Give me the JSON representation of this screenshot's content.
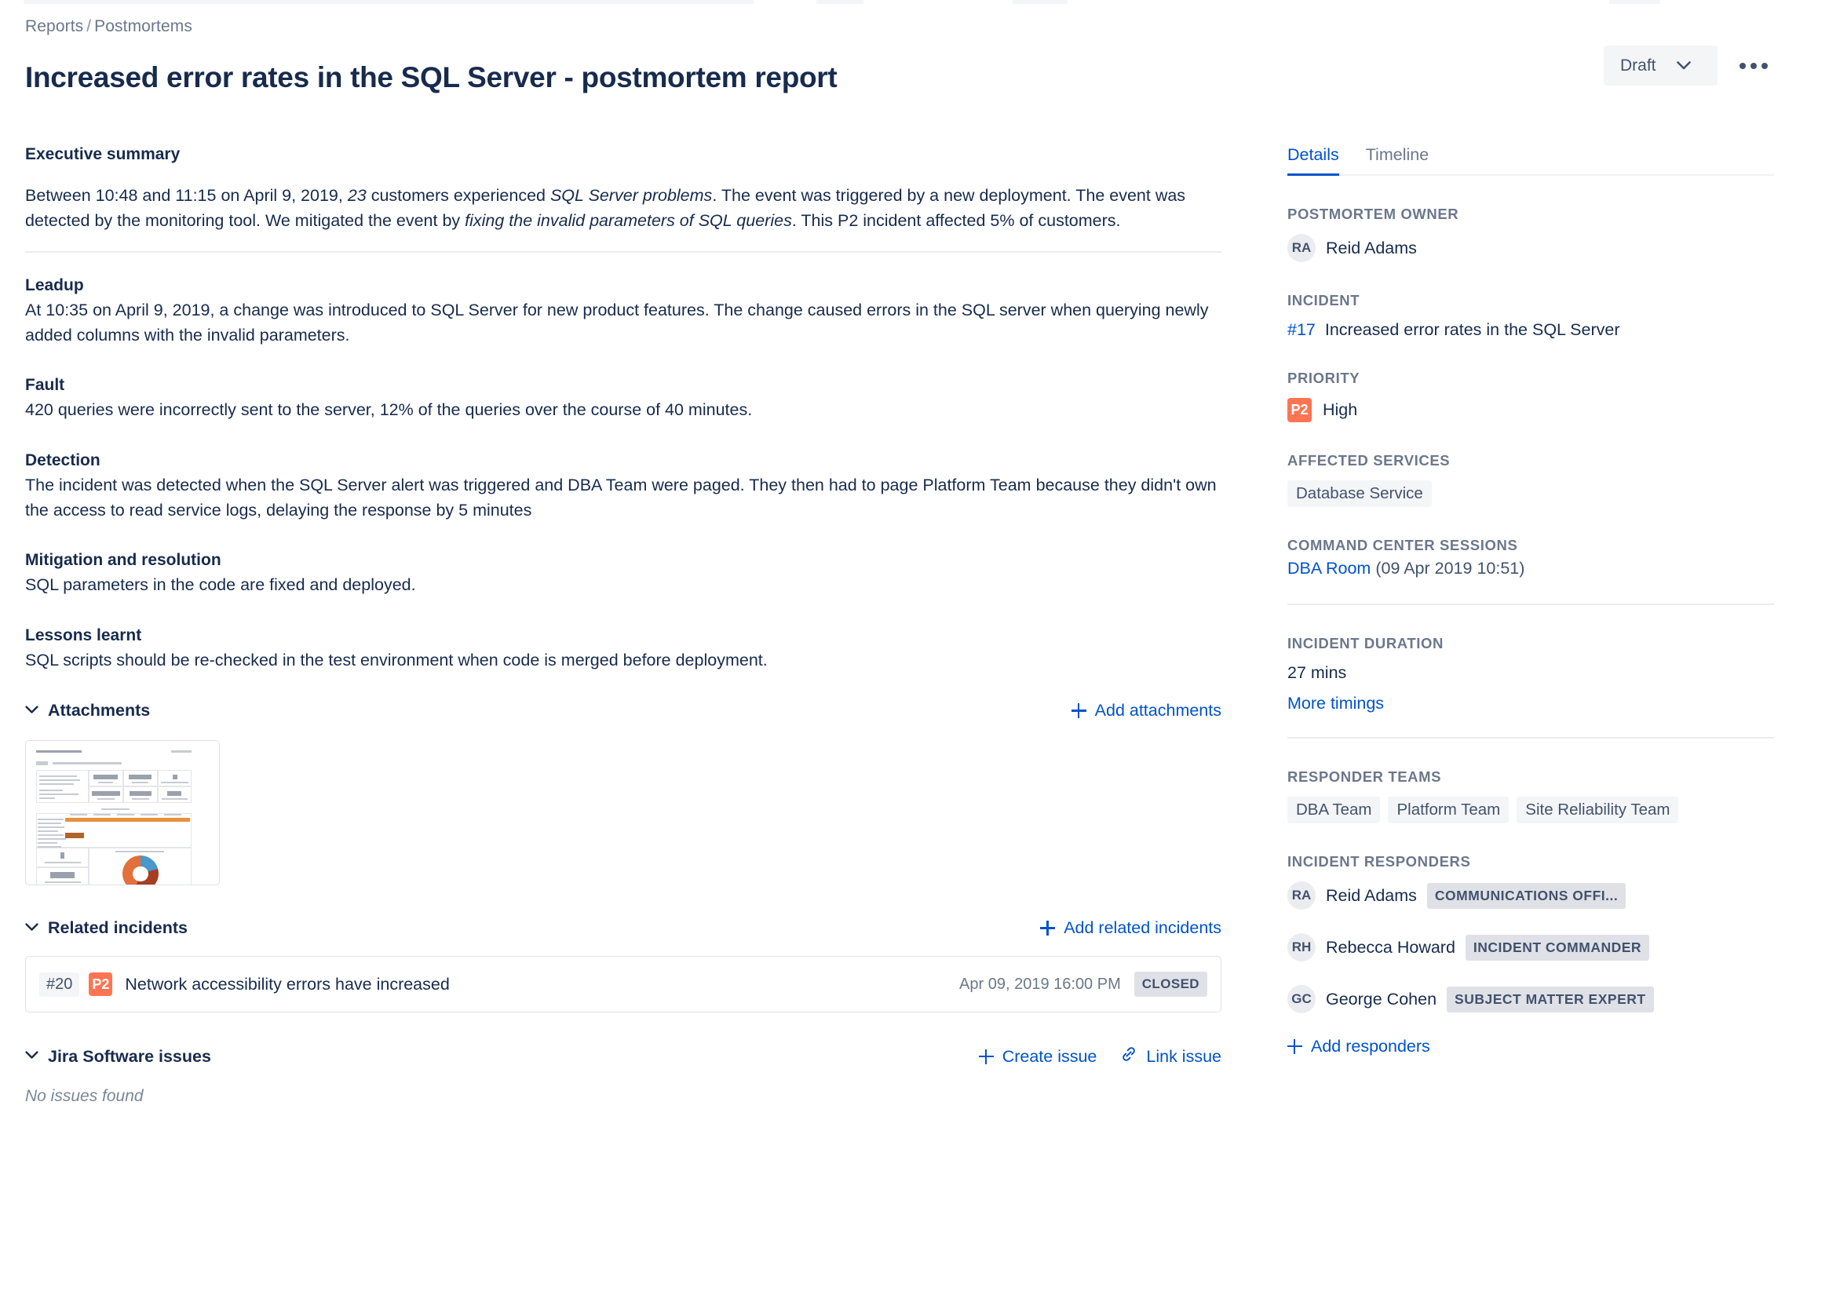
{
  "header": {
    "breadcrumb": {
      "parent": "Reports",
      "separator": "/",
      "current": "Postmortems"
    },
    "title": "Increased error rates in the SQL Server - postmortem report",
    "status_label": "Draft",
    "more_icon": "more-horizontal-icon",
    "chevron_icon": "chevron-down-icon"
  },
  "report": {
    "executive": {
      "heading": "Executive summary",
      "p1_a": "Between 10:48 and 11:15 on April 9, 2019, ",
      "p1_em1": "23",
      "p1_b": " customers experienced ",
      "p1_em2": "SQL Server problems",
      "p1_c": ". The event was triggered by a new deployment. The event was detected by the monitoring tool. We mitigated the event by ",
      "p1_em3": "fixing the invalid parameters of SQL queries",
      "p1_d": ". This P2 incident affected 5% of customers."
    },
    "sections": [
      {
        "heading": "Leadup",
        "body": "At 10:35 on April 9, 2019, a change was introduced to SQL Server for new product features. The change caused errors in the SQL server when querying newly added columns with the invalid parameters."
      },
      {
        "heading": "Fault",
        "body": "420 queries were incorrectly sent to the server, 12% of the queries over the course of 40 minutes."
      },
      {
        "heading": "Detection",
        "body": "The incident was detected when the SQL Server alert was triggered and DBA Team were paged. They then had to page Platform Team because they didn't own the access to read service logs, delaying the response by 5 minutes"
      },
      {
        "heading": "Mitigation and resolution",
        "body": "SQL parameters in the code are fixed and deployed."
      },
      {
        "heading": "Lessons learnt",
        "body": "SQL scripts should be re-checked in the test environment when code is merged before deployment."
      }
    ],
    "attachments": {
      "title": "Attachments",
      "add_label": "Add attachments",
      "collapse_icon": "chevron-down-icon",
      "add_icon": "plus-icon",
      "thumbnail_name": "postmortem-report-preview"
    },
    "related_incidents": {
      "title": "Related incidents",
      "add_label": "Add related incidents",
      "collapse_icon": "chevron-down-icon",
      "add_icon": "plus-icon",
      "rows": [
        {
          "id": "#20",
          "priority": "P2",
          "title": "Network accessibility errors have increased",
          "date": "Apr 09, 2019 16:00 PM",
          "status": "CLOSED"
        }
      ]
    },
    "jira_issues": {
      "title": "Jira Software issues",
      "collapse_icon": "chevron-down-icon",
      "create_label": "Create issue",
      "create_icon": "plus-icon",
      "link_label": "Link issue",
      "link_icon": "link-icon",
      "empty_text": "No issues found"
    }
  },
  "sidebar": {
    "tabs": [
      {
        "label": "Details",
        "active": true
      },
      {
        "label": "Timeline",
        "active": false
      }
    ],
    "postmortem_owner": {
      "label": "POSTMORTEM OWNER",
      "initials": "RA",
      "name": "Reid Adams"
    },
    "incident": {
      "label": "INCIDENT",
      "key": "#17",
      "summary": "Increased error rates in the SQL Server"
    },
    "priority": {
      "label": "PRIORITY",
      "badge": "P2",
      "value": "High"
    },
    "affected_services": {
      "label": "AFFECTED SERVICES",
      "items": [
        "Database Service"
      ]
    },
    "command_center_sessions": {
      "label": "COMMAND CENTER SESSIONS",
      "room": "DBA Room",
      "timestamp": "(09 Apr 2019 10:51)"
    },
    "incident_duration": {
      "label": "INCIDENT DURATION",
      "value": "27 mins",
      "more_label": "More timings"
    },
    "responder_teams": {
      "label": "RESPONDER TEAMS",
      "items": [
        "DBA Team",
        "Platform Team",
        "Site Reliability Team"
      ]
    },
    "incident_responders": {
      "label": "INCIDENT RESPONDERS",
      "people": [
        {
          "initials": "RA",
          "name": "Reid Adams",
          "role": "COMMUNICATIONS OFFI..."
        },
        {
          "initials": "RH",
          "name": "Rebecca Howard",
          "role": "INCIDENT COMMANDER"
        },
        {
          "initials": "GC",
          "name": "George Cohen",
          "role": "SUBJECT MATTER EXPERT"
        }
      ],
      "add_label": "Add responders",
      "add_icon": "plus-icon"
    }
  },
  "colors": {
    "link": "#0052CC",
    "priority_p2": "#FF7452",
    "text": "#172B4D",
    "muted": "#6B778C",
    "chip_bg": "#F4F5F7"
  }
}
